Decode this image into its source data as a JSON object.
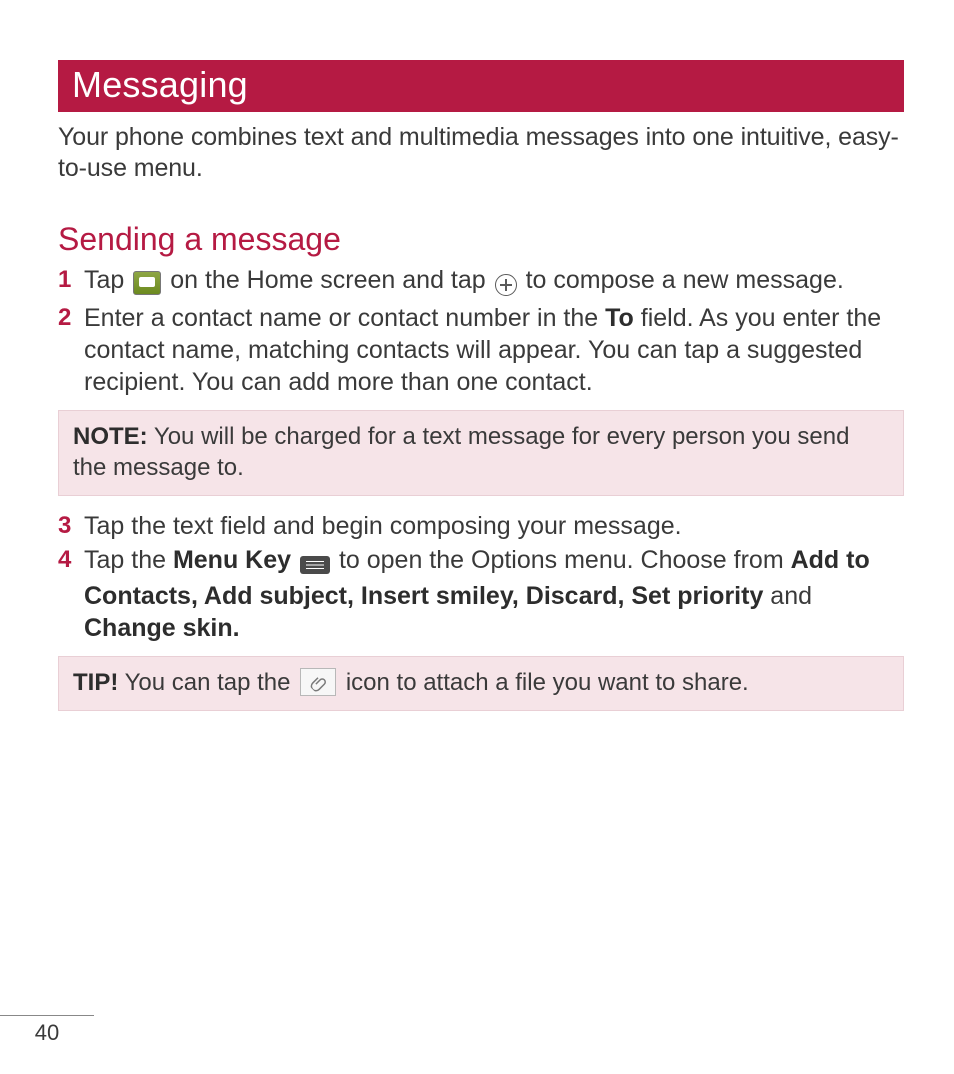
{
  "header": {
    "title": "Messaging"
  },
  "intro": "Your phone combines text and multimedia messages into one intuitive, easy-to-use menu.",
  "section": {
    "heading": "Sending a message"
  },
  "steps": {
    "s1": {
      "num": "1",
      "pre": "Tap ",
      "mid": " on the Home screen and tap ",
      "post": " to compose a new message."
    },
    "s2": {
      "num": "2",
      "pre": "Enter a contact name or contact number in the ",
      "to_label": "To",
      "post": " field. As you enter the contact name, matching contacts will appear. You can tap a suggested recipient. You can add more than one contact."
    },
    "s3": {
      "num": "3",
      "text": "Tap the text field and begin composing your message."
    },
    "s4": {
      "num": "4",
      "pre": "Tap the ",
      "menukey_label": "Menu Key",
      "mid": " to open the Options menu. Choose from ",
      "options": "Add to Contacts, Add subject, Insert smiley, Discard, Set priority",
      "and": " and ",
      "last_option": "Change skin."
    }
  },
  "note": {
    "label": "NOTE:",
    "text": " You will be charged for a text message for every person you send the message to."
  },
  "tip": {
    "label": "TIP!",
    "pre": " You can tap the ",
    "post": " icon to attach a file you want to share."
  },
  "page_number": "40"
}
